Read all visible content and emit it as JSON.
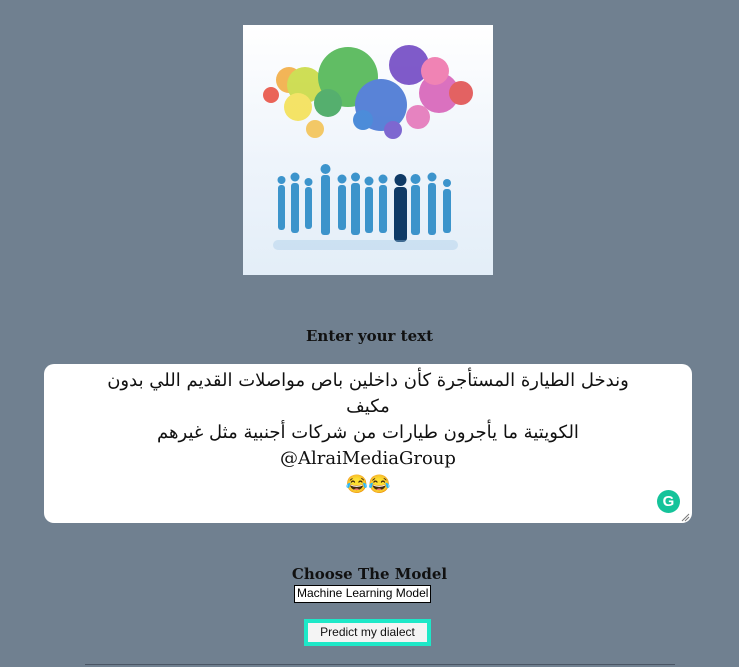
{
  "hero_image": {
    "icon": "people-speech-bubbles-illustration"
  },
  "text_section": {
    "label": "Enter your text",
    "value": "وندخل الطيارة المستأجرة كأن داخلين باص مواصلات القديم اللي بدون مكيف\nالكويتية ما يأجرون طيارات من شركات أجنبية مثل غيرهم AlraiMediaGroup@\n😂😂",
    "grammarly_icon": "G"
  },
  "model_section": {
    "label": "Choose The Model",
    "selected_model": "Machine Learning Model"
  },
  "predict_button": {
    "label": "Predict my dialect"
  },
  "colors": {
    "background": "#708090",
    "button_border": "#1ee8c8",
    "grammarly": "#15c39a"
  }
}
